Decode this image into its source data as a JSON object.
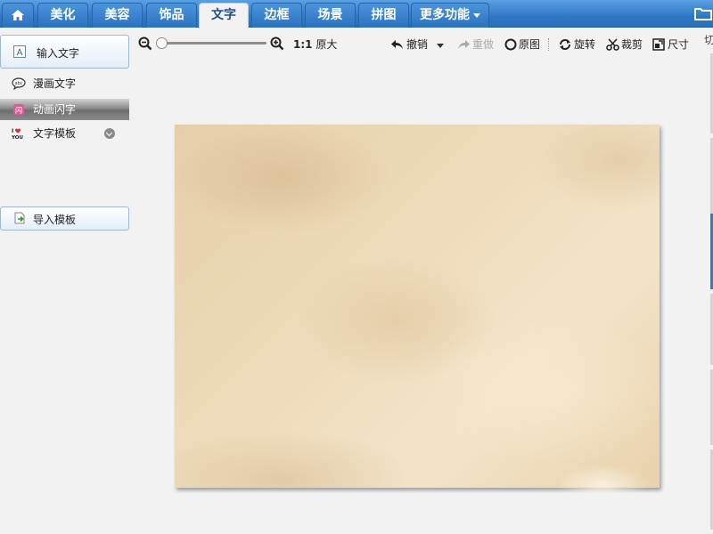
{
  "top_tabs": [
    {
      "label": ""
    },
    {
      "label": "美化"
    },
    {
      "label": "美容"
    },
    {
      "label": "饰品"
    },
    {
      "label": "文字"
    },
    {
      "label": "边框"
    },
    {
      "label": "场景"
    },
    {
      "label": "拼图"
    },
    {
      "label": "更多功能"
    }
  ],
  "active_tab": "文字",
  "left_panel": {
    "input_text_button": "输入文字",
    "items": [
      {
        "label": "漫画文字",
        "icon": "speech-bubble-icon"
      },
      {
        "label": "动画闪字",
        "icon": "sparkle-icon",
        "selected": true
      },
      {
        "label": "文字模板",
        "icon": "i-love-you-icon"
      }
    ],
    "import_template_button": "导入模板"
  },
  "toolbar": {
    "zoom_in_icon": "zoom-in-icon",
    "zoom_out_icon": "zoom-out-icon",
    "original_size_ratio": "1:1",
    "original_size_label": "原大",
    "undo_label": "撤销",
    "redo_label": "重做",
    "original_image_label": "原图",
    "rotate_label": "旋转",
    "crop_label": "裁剪",
    "size_label": "尺寸"
  },
  "right_panel": {
    "label": "切"
  },
  "colors": {
    "tab_bar": "#2f78c6",
    "selected_item": "#7a7a7a",
    "canvas_paper": "#ecd8b6"
  }
}
